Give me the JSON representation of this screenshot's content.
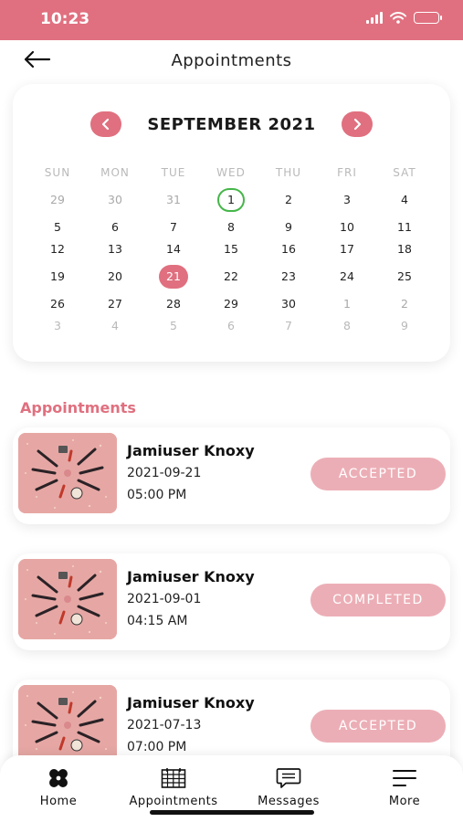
{
  "status_bar": {
    "time": "10:23"
  },
  "header": {
    "title": "Appointments"
  },
  "calendar": {
    "month_title": "SEPTEMBER 2021",
    "weekdays": [
      "SUN",
      "MON",
      "TUE",
      "WED",
      "THU",
      "FRI",
      "SAT"
    ],
    "weeks": [
      [
        "29",
        "30",
        "31",
        "1",
        "2",
        "3",
        "4"
      ],
      [
        "5",
        "6",
        "7",
        "8",
        "9",
        "10",
        "11"
      ],
      [
        "12",
        "13",
        "14",
        "15",
        "16",
        "17",
        "18"
      ],
      [
        "19",
        "20",
        "21",
        "22",
        "23",
        "24",
        "25"
      ],
      [
        "26",
        "27",
        "28",
        "29",
        "30",
        "1",
        "2"
      ],
      [
        "3",
        "4",
        "5",
        "6",
        "7",
        "8",
        "9"
      ]
    ],
    "today_day": "1",
    "selected_day": "21"
  },
  "appointments_section": {
    "title": "Appointments",
    "items": [
      {
        "name": "Jamiuser Knoxy",
        "date": "2021-09-21",
        "time": "05:00 PM",
        "status": "ACCEPTED"
      },
      {
        "name": "Jamiuser Knoxy",
        "date": "2021-09-01",
        "time": "04:15 AM",
        "status": "COMPLETED"
      },
      {
        "name": "Jamiuser Knoxy",
        "date": "2021-07-13",
        "time": "07:00 PM",
        "status": "ACCEPTED"
      }
    ]
  },
  "tab_bar": {
    "items": [
      {
        "label": "Home",
        "icon": "bandage-icon"
      },
      {
        "label": "Appointments",
        "icon": "calendar-grid-icon"
      },
      {
        "label": "Messages",
        "icon": "chat-bubble-icon"
      },
      {
        "label": "More",
        "icon": "menu-lines-icon"
      }
    ]
  },
  "colors": {
    "accent": "#e0707f",
    "badge": "#ecaeb6",
    "today_ring": "#45b649"
  }
}
